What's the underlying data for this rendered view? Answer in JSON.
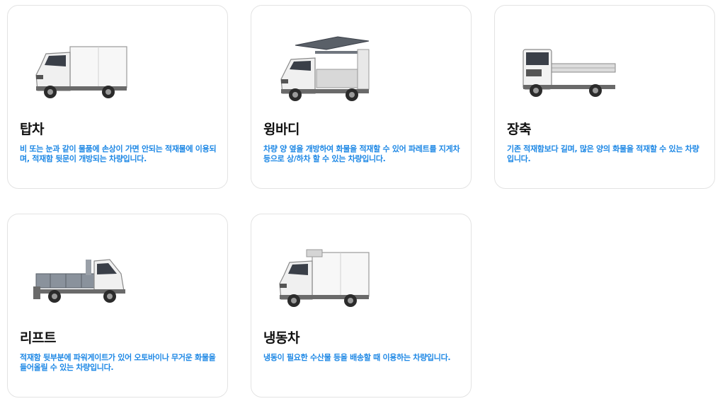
{
  "cards": [
    {
      "icon": "box-truck-icon",
      "title": "탑차",
      "description": "비 또는 눈과 같이 물품에 손상이 가면 안되는 적재물에 이용되며, 적재함 뒷문이 개방되는 차량입니다."
    },
    {
      "icon": "wing-body-truck-icon",
      "title": "윙바디",
      "description": "차량 양 옆을 개방하여 화물을 적재할 수 있어 파레트를 지게차 등으로 상/하차 할 수 있는 차량입니다."
    },
    {
      "icon": "long-cargo-truck-icon",
      "title": "장축",
      "description": "기존 적재함보다 길며, 많은 양의 화물을 적재할 수 있는 차량입니다."
    },
    {
      "icon": "lift-truck-icon",
      "title": "리프트",
      "description": "적재함 뒷부분에 파워게이트가 있어 오토바이나 무거운 화물을 들어올릴 수 있는 차량입니다."
    },
    {
      "icon": "refrigerated-truck-icon",
      "title": "냉동차",
      "description": "냉동이 필요한 수산물 등을 배송할 때 이용하는 차량입니다."
    }
  ]
}
